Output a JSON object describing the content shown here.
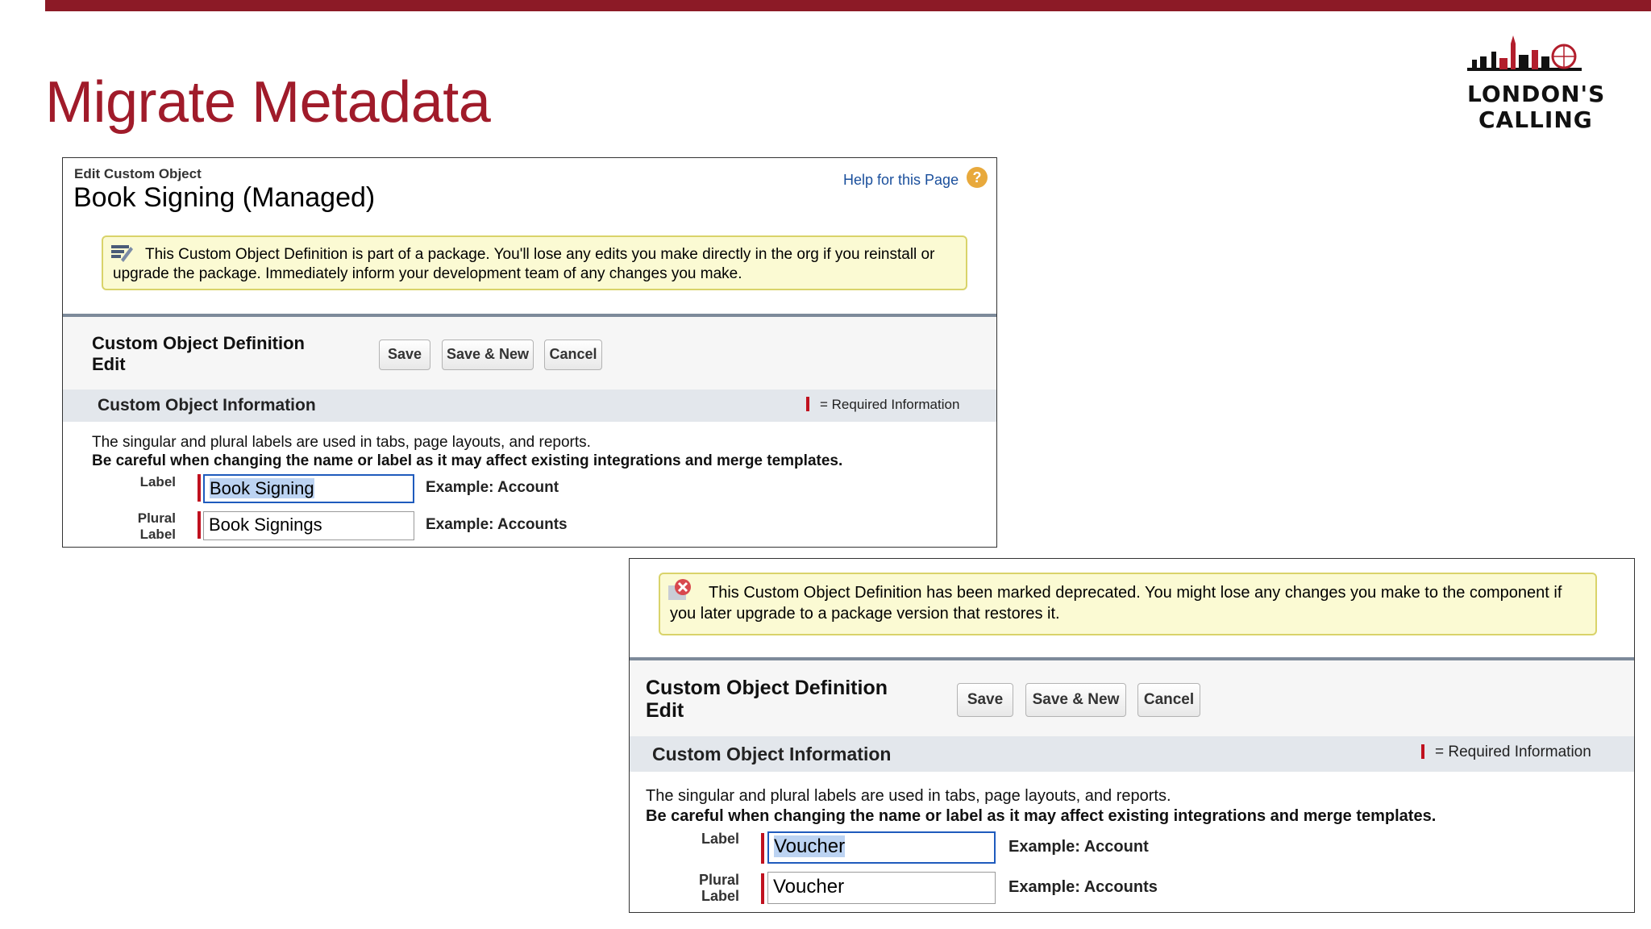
{
  "slide": {
    "title": "Migrate Metadata",
    "logo": {
      "line1": "LONDON'S",
      "line2": "CALLING"
    }
  },
  "panel1": {
    "eyebrow": "Edit Custom Object",
    "title": "Book Signing (Managed)",
    "help_link": "Help for this Page",
    "help_icon": "?",
    "banner_text": "This Custom Object Definition is part of a package. You'll lose any edits you make directly in the org if you reinstall or upgrade the package. Immediately inform your development team of any changes you make.",
    "section_title": "Custom Object Definition Edit",
    "buttons": {
      "save": "Save",
      "save_new": "Save & New",
      "cancel": "Cancel"
    },
    "info_title": "Custom Object Information",
    "required_text": "= Required Information",
    "desc_line1": "The singular and plural labels are used in tabs, page layouts, and reports.",
    "desc_line2": "Be careful when changing the name or label as it may affect existing integrations and merge templates.",
    "label_field": {
      "label": "Label",
      "value": "Book Signing",
      "example": "Example:  Account"
    },
    "plural_field": {
      "label": "Plural Label",
      "value": "Book Signings",
      "example": "Example:  Accounts"
    }
  },
  "panel2": {
    "banner_text": "This Custom Object Definition has been marked deprecated. You might lose any changes you make to the component if you later upgrade to a package version that restores it.",
    "section_title": "Custom Object Definition Edit",
    "buttons": {
      "save": "Save",
      "save_new": "Save & New",
      "cancel": "Cancel"
    },
    "info_title": "Custom Object Information",
    "required_text": "= Required Information",
    "desc_line1": "The singular and plural labels are used in tabs, page layouts, and reports.",
    "desc_line2": "Be careful when changing the name or label as it may affect existing integrations and merge templates.",
    "label_field": {
      "label": "Label",
      "value": "Voucher",
      "example": "Example:  Account"
    },
    "plural_field": {
      "label": "Plural Label",
      "value": "Voucher",
      "example": "Example:  Accounts"
    }
  },
  "colors": {
    "brand": "#a01b2a",
    "banner": "#fbfad3",
    "required": "#c0111f"
  },
  "icons": [
    "london-skyline-icon",
    "help-icon",
    "package-edit-icon",
    "deprecated-warning-icon"
  ]
}
